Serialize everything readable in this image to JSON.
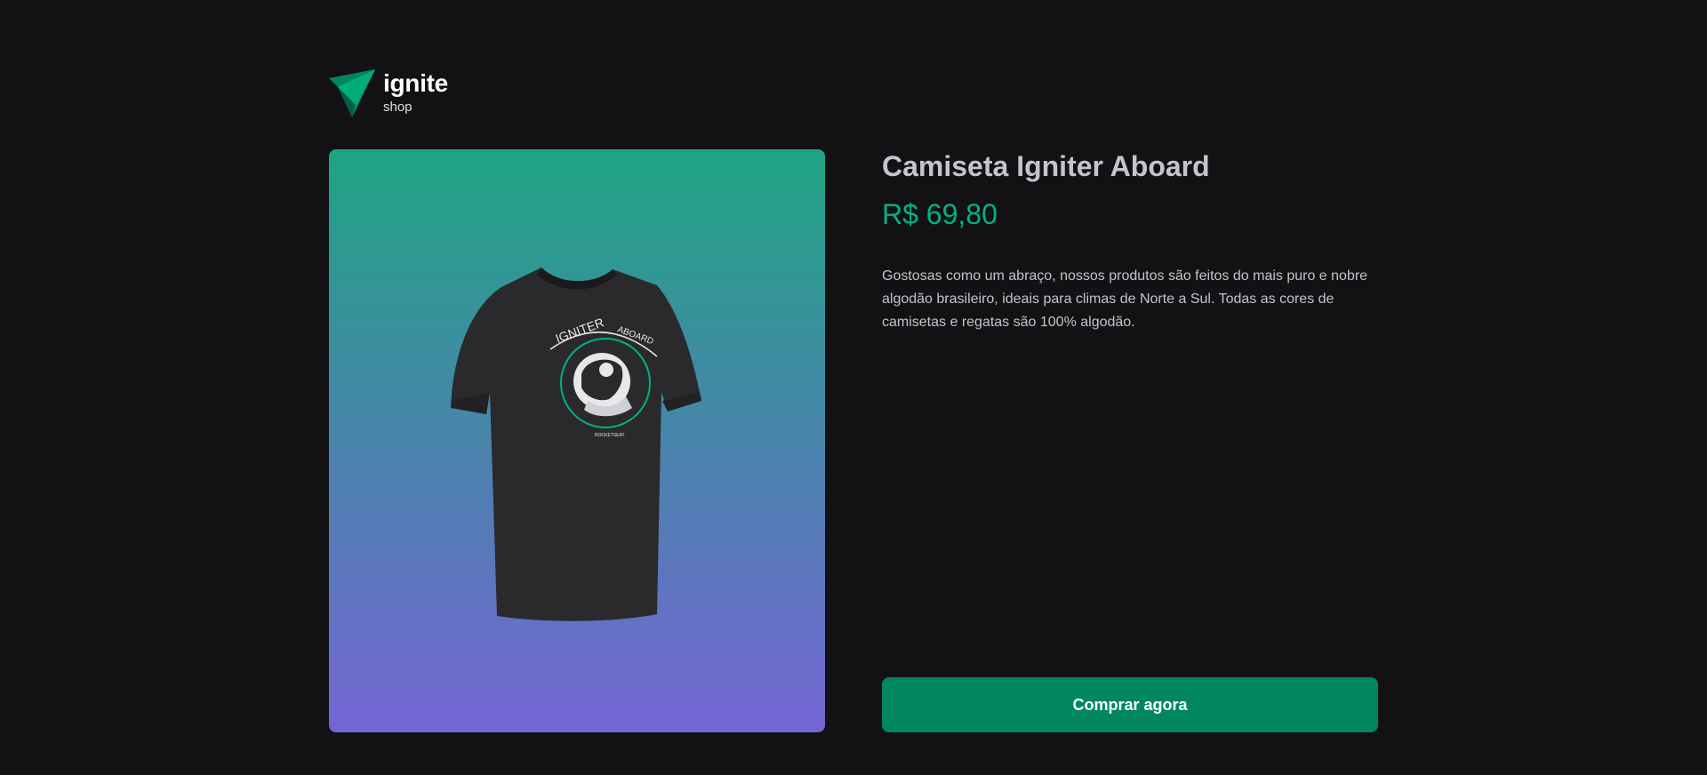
{
  "header": {
    "logo_title": "ignite",
    "logo_subtitle": "shop",
    "logo_icon": "ignite-triangle-logo"
  },
  "product": {
    "image_alt": "Camiseta Igniter Aboard",
    "image_icon": "tshirt-image",
    "name": "Camiseta Igniter Aboard",
    "price": "R$ 69,80",
    "description": "Gostosas como um abraço, nossos produtos são feitos do mais puro e nobre algodão brasileiro, ideais para climas de Norte a Sul. Todas as cores de camisetas e regatas são 100% algodão.",
    "buy_label": "Comprar agora"
  },
  "colors": {
    "background": "#121214",
    "accent": "#00875f",
    "price": "#00b37e",
    "gradient_top": "#1ea483",
    "gradient_bottom": "#7465d4"
  }
}
